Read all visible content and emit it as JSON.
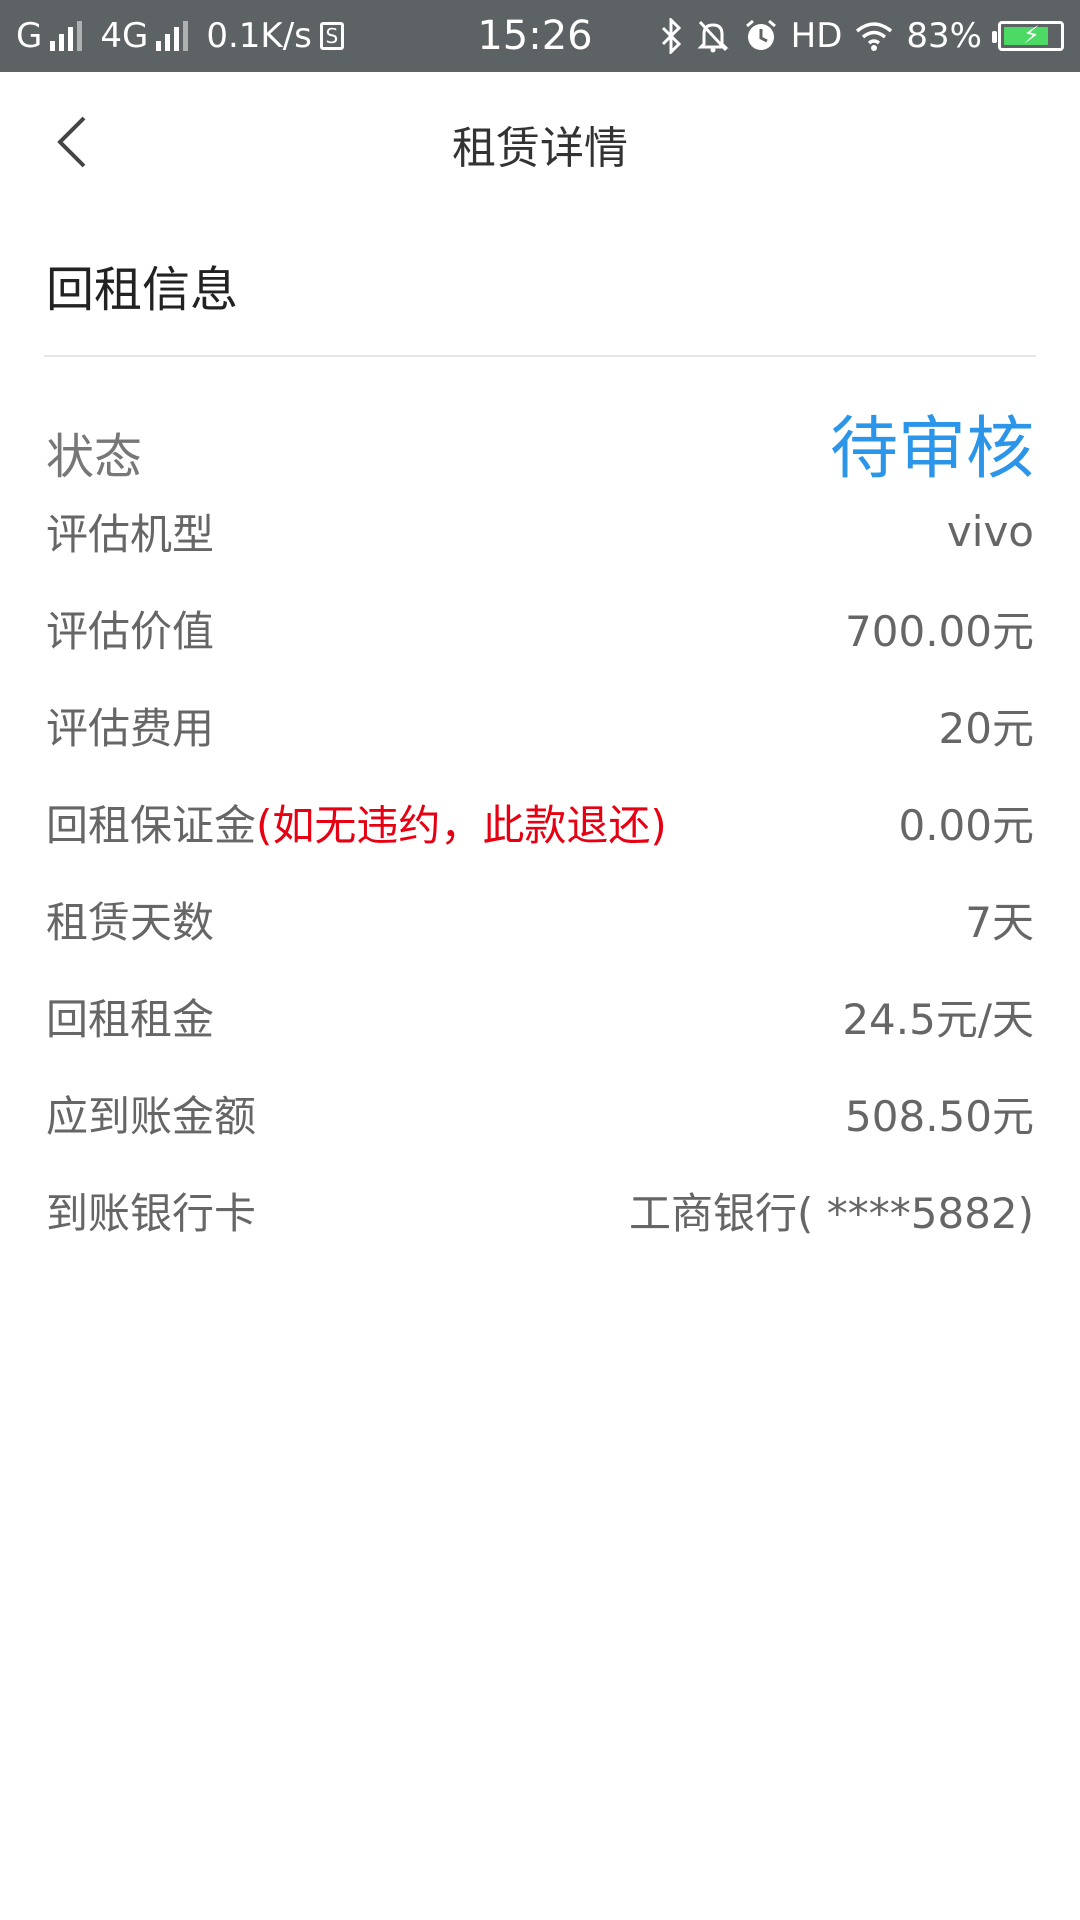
{
  "status_bar": {
    "sim1_label": "G",
    "sim2_label": "4G",
    "net_speed": "0.1K/s",
    "s_icon_label": "S",
    "time": "15:26",
    "hd_label": "HD",
    "battery_percent": "83%",
    "battery_level": 0.83,
    "icons": [
      "signal-icon",
      "s-app-icon",
      "bluetooth-icon",
      "mute-bell-icon",
      "alarm-icon",
      "wifi-icon",
      "battery-icon"
    ]
  },
  "nav": {
    "title": "租赁详情"
  },
  "section": {
    "title": "回租信息"
  },
  "status": {
    "label": "状态",
    "value": "待审核"
  },
  "details": [
    {
      "label": "评估机型",
      "value": "vivo"
    },
    {
      "label": "评估价值",
      "value": "700.00元"
    },
    {
      "label": "评估费用",
      "value": "20元"
    },
    {
      "label": "回租保证金",
      "note": "(如无违约，此款退还)",
      "value": "0.00元"
    },
    {
      "label": "租赁天数",
      "value": "7天"
    },
    {
      "label": "回租租金",
      "value": "24.5元/天"
    },
    {
      "label": "应到账金额",
      "value": "508.50元"
    },
    {
      "label": "到账银行卡",
      "value": "工商银行( ****5882)"
    }
  ],
  "colors": {
    "status_bar_bg": "#5d6264",
    "accent_blue": "#2b95e9",
    "note_red": "#e60012",
    "battery_green": "#4cd964"
  }
}
